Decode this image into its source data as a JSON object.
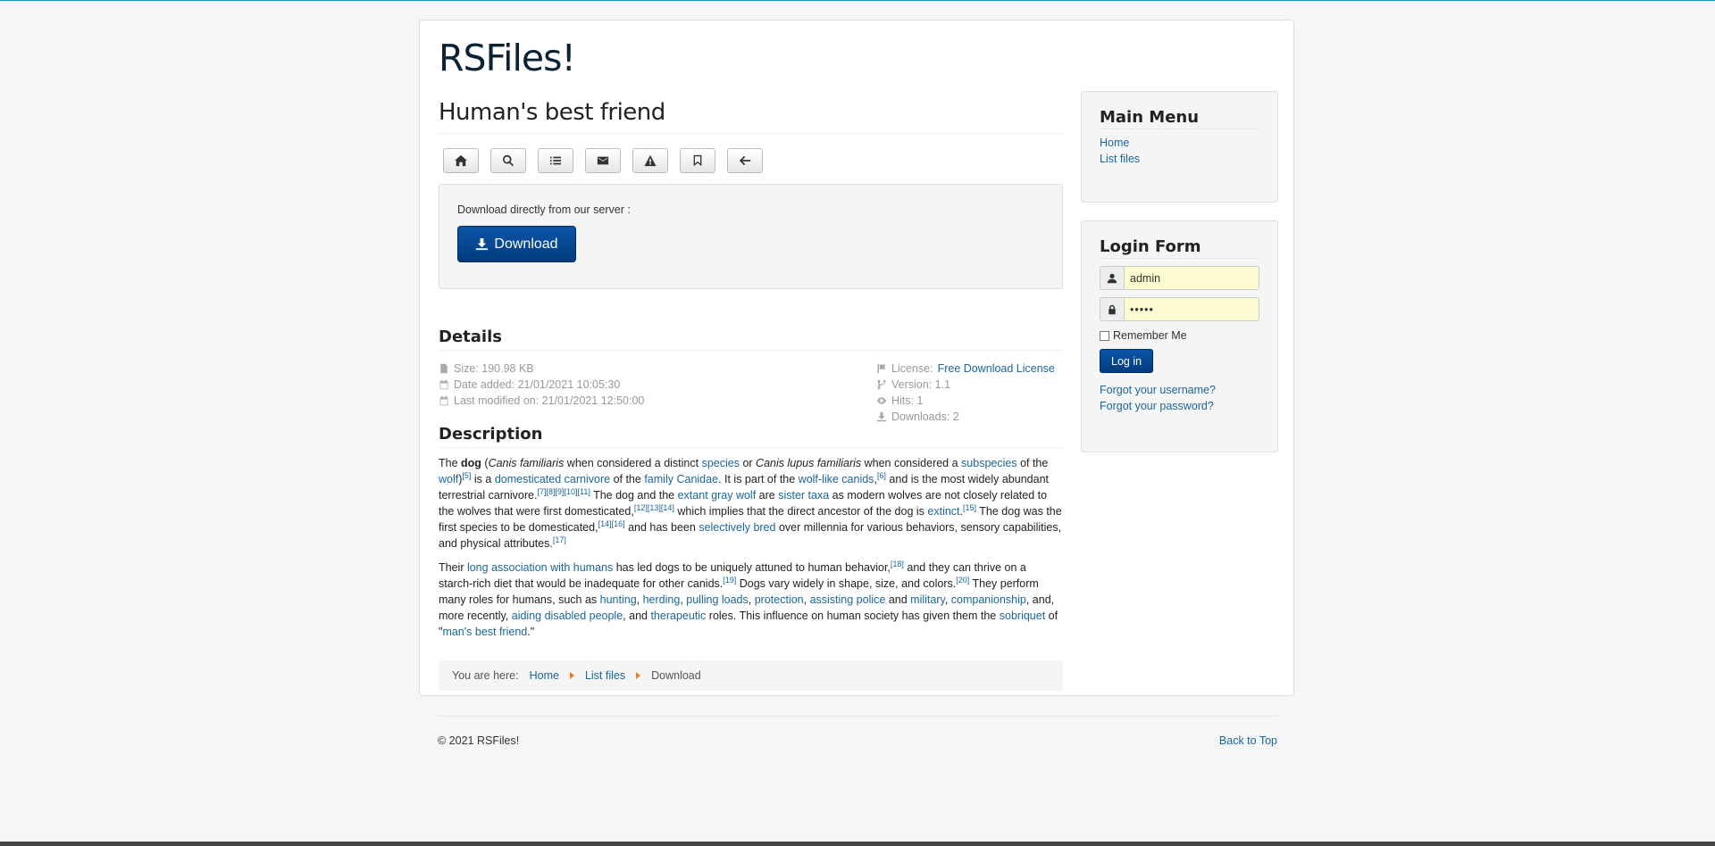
{
  "site": {
    "brand": "RSFiles!"
  },
  "page": {
    "title": "Human's best friend"
  },
  "toolbar": {
    "buttons": [
      {
        "icon": "home-icon"
      },
      {
        "icon": "search-icon"
      },
      {
        "icon": "list-icon"
      },
      {
        "icon": "envelope-icon"
      },
      {
        "icon": "warning-icon"
      },
      {
        "icon": "bookmark-icon"
      },
      {
        "icon": "arrow-left-icon"
      }
    ]
  },
  "download": {
    "text": "Download directly from our server :",
    "button_label": "Download"
  },
  "details": {
    "heading": "Details",
    "size": "Size: 190.98 KB",
    "date_added": "Date added: 21/01/2021 10:05:30",
    "last_modified": "Last modified on: 21/01/2021 12:50:00",
    "license_label": "License:",
    "license_link": "Free Download License",
    "version": "Version: 1.1",
    "hits": "Hits: 1",
    "downloads": "Downloads: 2"
  },
  "description": {
    "heading": "Description",
    "p1": {
      "t1": "The ",
      "b1": "dog",
      "t2": " (",
      "i1": "Canis familiaris",
      "t3": " when considered a distinct ",
      "a1": "species",
      "t4": " or ",
      "i2": "Canis lupus familiaris",
      "t5": " when considered a ",
      "a2": "subspecies",
      "t6": " of the ",
      "a3": "wolf",
      "t7": ")",
      "s1": "[5]",
      "t8": " is a ",
      "a4": "domesticated",
      "t9": " ",
      "a5": "carnivore",
      "t10": " of the ",
      "a6": "family",
      "t11": " ",
      "a7": "Canidae",
      "t12": ". It is part of the ",
      "a8": "wolf-like canids",
      "t13": ",",
      "s2": "[6]",
      "t14": " and is the most widely abundant terrestrial carnivore.",
      "s3": "[7][8][9][10][11]",
      "t15": " The dog and the ",
      "a9": "extant",
      "t16": " ",
      "a10": "gray wolf",
      "t17": " are ",
      "a11": "sister taxa",
      "t18": " as modern wolves are not closely related to the wolves that were first domesticated,",
      "s4": "[12][13][14]",
      "t19": " which implies that the direct ancestor of the dog is ",
      "a12": "extinct",
      "t20": ".",
      "s5": "[15]",
      "t21": " The dog was the first species to be domesticated,",
      "s6": "[14][16]",
      "t22": " and has been ",
      "a13": "selectively bred",
      "t23": " over millennia for various behaviors, sensory capabilities, and physical attributes.",
      "s7": "[17]"
    },
    "p2": {
      "t1": "Their ",
      "a1": "long association with humans",
      "t2": " has led dogs to be uniquely attuned to human behavior,",
      "s1": "[18]",
      "t3": " and they can thrive on a starch-rich diet that would be inadequate for other canids.",
      "s2": "[19]",
      "t4": " Dogs vary widely in shape, size, and colors.",
      "s3": "[20]",
      "t5": " They perform many roles for humans, such as ",
      "a2": "hunting",
      "t6": ", ",
      "a3": "herding",
      "t7": ", ",
      "a4": "pulling loads",
      "t8": ", ",
      "a5": "protection",
      "t9": ", ",
      "a6": "assisting police",
      "t10": " and ",
      "a7": "military",
      "t11": ", ",
      "a8": "companionship",
      "t12": ", and, more recently, ",
      "a9": "aiding disabled people",
      "t13": ", and ",
      "a10": "therapeutic",
      "t14": " roles. This influence on human society has given them the ",
      "a11": "sobriquet",
      "t15": " of \"",
      "a12": "man's best friend",
      "t16": ".\""
    }
  },
  "breadcrumb": {
    "label": "You are here:",
    "items": [
      "Home",
      "List files",
      "Download"
    ]
  },
  "main_menu": {
    "title": "Main Menu",
    "items": [
      "Home",
      "List files"
    ]
  },
  "login": {
    "title": "Login Form",
    "username": "admin",
    "password": "•••••",
    "remember": "Remember Me",
    "button": "Log in",
    "forgot_username": "Forgot your username?",
    "forgot_password": "Forgot your password?"
  },
  "footer": {
    "copyright": "© 2021 RSFiles!",
    "back_to_top": "Back to Top"
  },
  "colors": {
    "accent": "#1c8fc6",
    "button_primary": "#003b7d",
    "link": "#1a6699",
    "breadcrumb_sep": "#e67e22"
  }
}
